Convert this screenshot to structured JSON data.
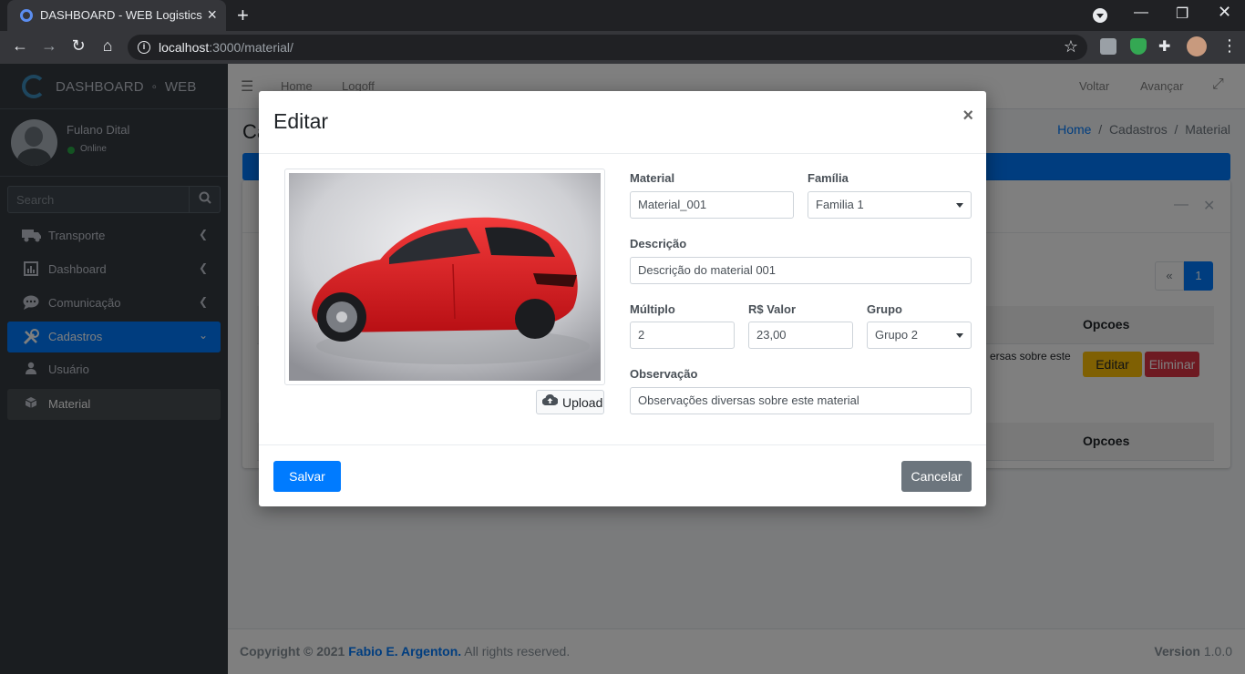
{
  "browser": {
    "tab_title": "DASHBOARD - WEB Logistics",
    "url_host": "localhost",
    "url_path": ":3000/material/"
  },
  "brand": {
    "name": "DASHBOARD",
    "suffix": "WEB"
  },
  "user": {
    "name": "Fulano Dital",
    "status": "Online"
  },
  "sidebar": {
    "search_placeholder": "Search",
    "items": [
      {
        "label": "Transporte",
        "icon": "truck-icon"
      },
      {
        "label": "Dashboard",
        "icon": "chart-icon"
      },
      {
        "label": "Comunicação",
        "icon": "chat-icon"
      },
      {
        "label": "Cadastros",
        "icon": "tools-icon"
      },
      {
        "label": "Usuário",
        "icon": "user-icon"
      },
      {
        "label": "Material",
        "icon": "box-icon"
      }
    ]
  },
  "topnav": {
    "home": "Home",
    "logoff": "Logoff",
    "back": "Voltar",
    "forward": "Avançar"
  },
  "page": {
    "title": "Ca",
    "breadcrumb": {
      "home": "Home",
      "sep": "/",
      "cadastros": "Cadastros",
      "current": "Material"
    }
  },
  "table": {
    "pagination_prev": "«",
    "pagination_page": "1",
    "col_options": "Opcoes",
    "row_text": "ersas sobre este",
    "edit_label": "Editar",
    "delete_label": "Eliminar"
  },
  "footer": {
    "copyright": "Copyright © 2021",
    "author": "Fabio E. Argenton.",
    "rights": "All rights reserved.",
    "version_label": "Version",
    "version": "1.0.0"
  },
  "modal": {
    "title": "Editar",
    "close": "×",
    "upload_label": "Upload",
    "fields": {
      "material_label": "Material",
      "material_value": "Material_001",
      "familia_label": "Família",
      "familia_value": "Familia 1",
      "descricao_label": "Descrição",
      "descricao_value": "Descrição do material 001",
      "multiplo_label": "Múltiplo",
      "multiplo_value": "2",
      "valor_label": "R$ Valor",
      "valor_value": "23,00",
      "grupo_label": "Grupo",
      "grupo_value": "Grupo 2",
      "observacao_label": "Observação",
      "observacao_value": "Observações diversas sobre este material"
    },
    "save_label": "Salvar",
    "cancel_label": "Cancelar"
  },
  "colors": {
    "primary": "#007bff",
    "sidebar": "#343a40",
    "warning": "#ffc107",
    "danger": "#dc3545",
    "secondary": "#6c757d"
  }
}
